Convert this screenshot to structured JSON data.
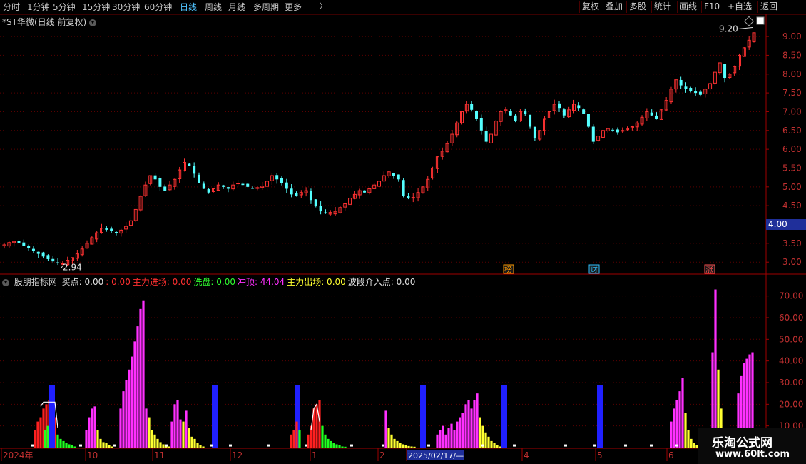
{
  "toolbar": {
    "periods": [
      "分时",
      "1分钟",
      "5分钟",
      "15分钟",
      "30分钟",
      "60分钟",
      "日线",
      "周线",
      "月线",
      "多周期",
      "更多"
    ],
    "active_period": "日线",
    "more_arrow": "〉",
    "right_buttons": [
      "复权",
      "叠加",
      "多股",
      "统计",
      "画线",
      "F10",
      "+自选",
      "返回"
    ]
  },
  "chart_title": {
    "stock": "*ST华微(日线 前复权)",
    "dropdown_icon": "chevron-down-icon"
  },
  "indicator": {
    "name": "股朋指标网",
    "items": [
      {
        "label": "买点:",
        "value": "0.00",
        "color": "#e0e0e0"
      },
      {
        "label": ":",
        "value": "0.00",
        "color": "#ff3030"
      },
      {
        "label": "主力进场:",
        "value": "0.00",
        "color": "#ff3030"
      },
      {
        "label": "洗盘:",
        "value": "0.00",
        "color": "#30ff30"
      },
      {
        "label": "冲顶:",
        "value": "44.04",
        "color": "#ff30ff"
      },
      {
        "label": "主力出场:",
        "value": "0.00",
        "color": "#ffff30"
      },
      {
        "label": "波段介入点:",
        "value": "0.00",
        "color": "#e0e0e0"
      }
    ]
  },
  "price_axis": {
    "labels": [
      "9.00",
      "8.50",
      "8.00",
      "7.50",
      "7.00",
      "6.50",
      "6.00",
      "5.50",
      "5.00",
      "4.50",
      "4.00",
      "3.50",
      "3.00"
    ],
    "highlight": "4.00"
  },
  "indicator_axis": {
    "labels": [
      "70.00",
      "60.00",
      "50.00",
      "40.00",
      "30.00",
      "20.00",
      "10.00"
    ]
  },
  "annotations": {
    "high": "9.20",
    "low": "2.94",
    "markers": [
      "榜",
      "财",
      "涨"
    ]
  },
  "date_axis": {
    "labels": [
      "2024年",
      "10",
      "11",
      "12",
      "1",
      "2",
      "2025/02/17/—",
      "4",
      "5",
      "6"
    ]
  },
  "watermark": {
    "name": "乐淘公式网",
    "url": "www.60lt.com"
  },
  "chart_data": [
    {
      "type": "candlestick",
      "title": "*ST华微(日线 前复权)",
      "ylim": [
        2.7,
        9.4
      ],
      "high_label": 9.2,
      "low_label": 2.94,
      "closes": [
        3.46,
        3.52,
        3.55,
        3.5,
        3.44,
        3.38,
        3.3,
        3.22,
        3.15,
        3.08,
        3.02,
        2.98,
        2.96,
        3.05,
        3.12,
        3.22,
        3.35,
        3.5,
        3.65,
        3.78,
        3.9,
        3.86,
        3.82,
        3.8,
        3.85,
        3.95,
        4.1,
        4.4,
        4.75,
        5.05,
        5.3,
        5.2,
        5.0,
        4.9,
        5.05,
        5.2,
        5.45,
        5.65,
        5.55,
        5.35,
        5.1,
        4.95,
        4.85,
        4.95,
        5.05,
        5.0,
        4.95,
        5.05,
        5.1,
        5.05,
        5.0,
        4.95,
        4.98,
        5.02,
        5.15,
        5.3,
        5.2,
        5.1,
        4.95,
        4.8,
        4.75,
        4.85,
        4.9,
        4.65,
        4.5,
        4.35,
        4.3,
        4.32,
        4.35,
        4.45,
        4.55,
        4.7,
        4.8,
        4.9,
        4.85,
        4.95,
        5.05,
        5.15,
        5.3,
        5.4,
        5.3,
        5.2,
        4.75,
        4.7,
        4.72,
        4.85,
        5.0,
        5.2,
        5.5,
        5.8,
        5.95,
        6.15,
        6.4,
        6.7,
        7.0,
        7.2,
        7.05,
        6.8,
        6.5,
        6.2,
        6.4,
        6.75,
        7.0,
        7.05,
        6.9,
        6.75,
        7.0,
        6.95,
        6.6,
        6.3,
        6.5,
        6.8,
        7.0,
        7.2,
        7.1,
        6.9,
        7.05,
        7.2,
        7.1,
        6.95,
        6.6,
        6.2,
        6.35,
        6.5,
        6.55,
        6.5,
        6.45,
        6.5,
        6.55,
        6.6,
        6.7,
        6.85,
        7.0,
        6.9,
        6.8,
        7.05,
        7.3,
        7.6,
        7.85,
        7.7,
        7.6,
        7.55,
        7.5,
        7.45,
        7.6,
        7.75,
        8.05,
        8.3,
        7.9,
        8.0,
        8.2,
        8.5,
        8.7,
        8.9,
        9.1
      ]
    },
    {
      "type": "bar",
      "title": "股朋指标网",
      "ylim": [
        0,
        75
      ],
      "series_names": [
        "主力进场",
        "洗盘",
        "冲顶",
        "主力出场",
        "波段介入点"
      ]
    }
  ]
}
